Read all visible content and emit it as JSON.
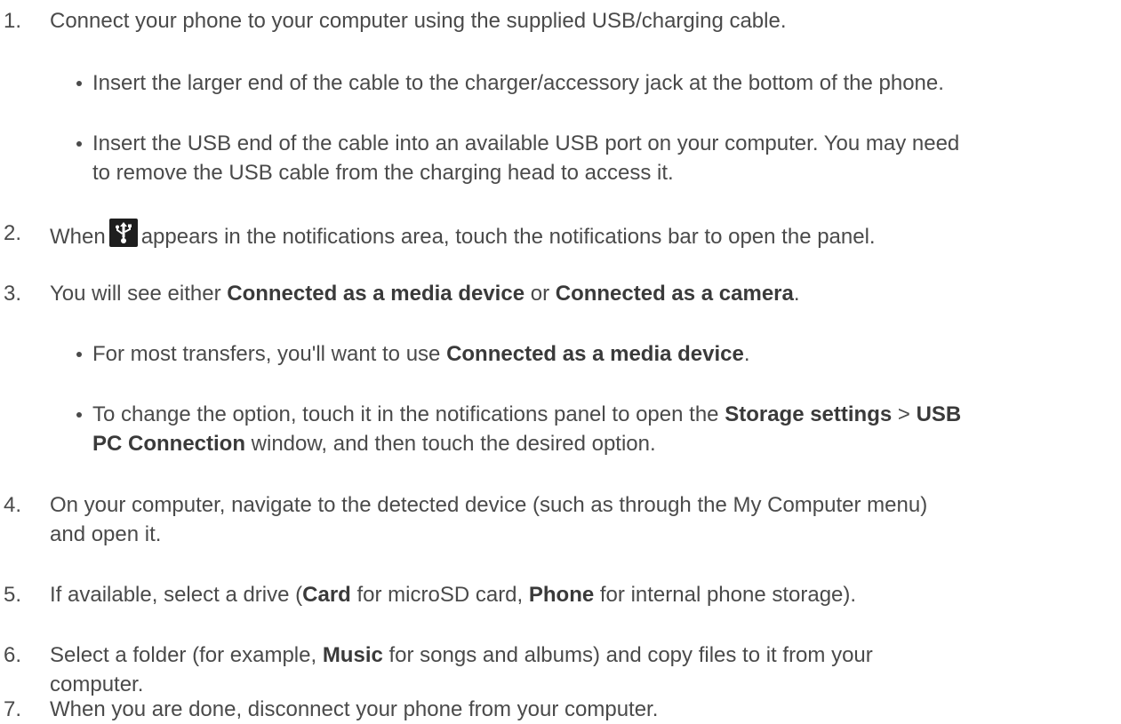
{
  "steps": [
    {
      "num": "1.",
      "text": "Connect your phone to your computer using the supplied USB/charging cable."
    },
    {
      "num": "2.",
      "pre": "When",
      "post": "appears in the notifications area, touch the notifications bar to open the panel.",
      "icon": "usb-icon"
    },
    {
      "num": "3.",
      "t1": "You will see either ",
      "b1": "Connected as a media device",
      "t2": " or ",
      "b2": "Connected as a camera",
      "t3": "."
    },
    {
      "num": "4.",
      "line1": "On your computer, navigate to the detected device (such as through the My Computer menu)",
      "line2": "and open it."
    },
    {
      "num": "5.",
      "t1": "If available, select a drive (",
      "b1": "Card",
      "t2": " for microSD card, ",
      "b2": "Phone",
      "t3": " for internal phone storage)."
    },
    {
      "num": "6.",
      "t1": "Select a folder (for example, ",
      "b1": "Music",
      "t2": " for songs and albums) and copy files to it from your",
      "line2": "computer."
    },
    {
      "num": "7.",
      "text": "When you are done, disconnect your phone from your computer."
    }
  ],
  "bullets1": [
    {
      "text": "Insert the larger end of the cable to the charger/accessory jack at the bottom of the phone."
    },
    {
      "line1": "Insert the USB end of the cable into an available USB port on your computer. You may need",
      "line2": "to remove the USB cable from the charging head to access it."
    }
  ],
  "bullets3": [
    {
      "t1": "For most transfers, you'll want to use ",
      "b1": "Connected as a media device",
      "t2": "."
    },
    {
      "t1": "To change the option, touch it in the notifications panel to open the ",
      "b1": "Storage settings",
      "t2": " > ",
      "b2": "USB",
      "b3": "PC Connection",
      "t3": " window, and then touch the desired option."
    }
  ]
}
